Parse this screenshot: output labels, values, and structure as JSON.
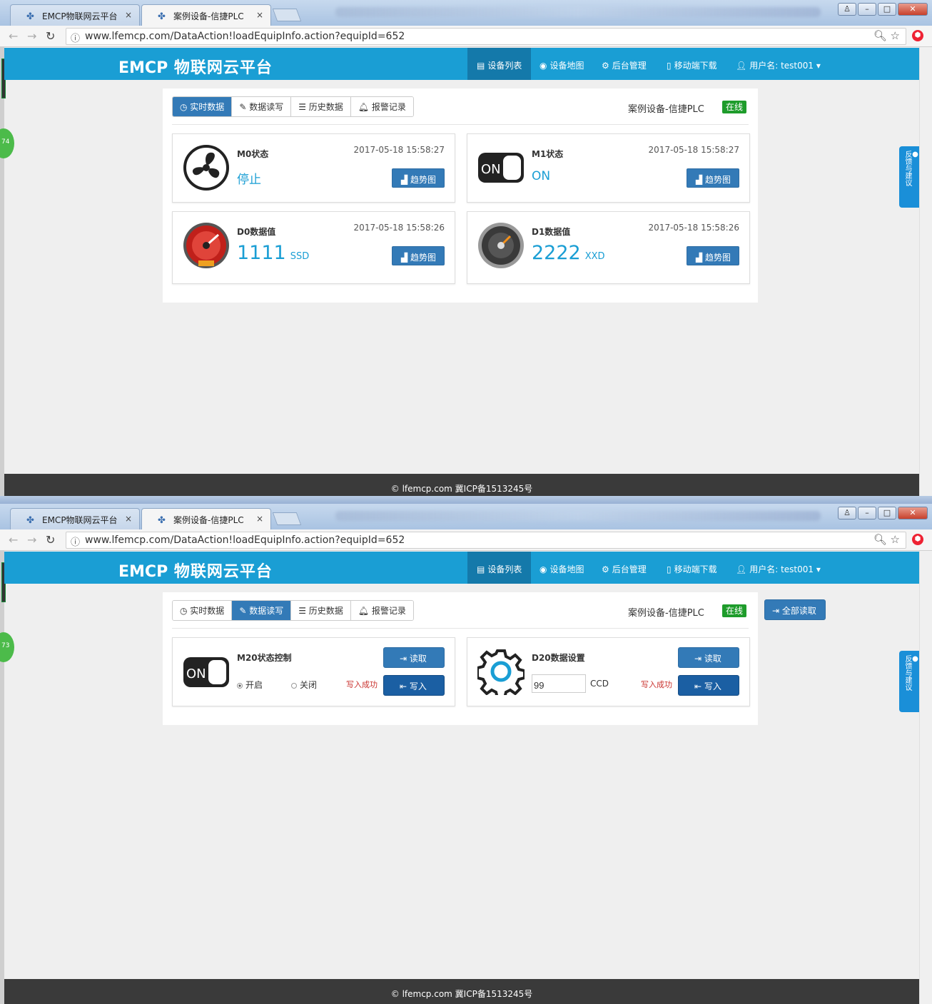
{
  "browser": {
    "tabs": [
      {
        "label": "EMCP物联网云平台"
      },
      {
        "label": "案例设备-信捷PLC"
      }
    ],
    "close_glyph": "×",
    "url": "www.lfemcp.com/DataAction!loadEquipInfo.action?equipId=652"
  },
  "side_badges": [
    "74",
    "73"
  ],
  "header": {
    "logo_brand": "EMCP",
    "logo_text": "物联网云平台",
    "menu": [
      {
        "label": "设备列表",
        "icon": "list-icon"
      },
      {
        "label": "设备地图",
        "icon": "globe-icon"
      },
      {
        "label": "后台管理",
        "icon": "gears-icon"
      },
      {
        "label": "移动端下载",
        "icon": "mobile-icon"
      },
      {
        "label": "用户名: test001",
        "icon": "user-icon"
      }
    ]
  },
  "subtabs": [
    {
      "label": "实时数据",
      "icon": "clock-icon"
    },
    {
      "label": "数据读写",
      "icon": "pencil-icon"
    },
    {
      "label": "历史数据",
      "icon": "list-icon"
    },
    {
      "label": "报警记录",
      "icon": "bell-icon"
    }
  ],
  "device": {
    "name": "案例设备-信捷PLC",
    "status": "在线"
  },
  "realtime": {
    "trend_label": "趋势图",
    "cards": [
      {
        "title": "M0状态",
        "time": "2017-05-18 15:58:27",
        "value": "停止",
        "icon": "fan-icon"
      },
      {
        "title": "M1状态",
        "time": "2017-05-18 15:58:27",
        "value": "ON",
        "icon": "switch-on-icon"
      },
      {
        "title": "D0数据值",
        "time": "2017-05-18 15:58:26",
        "value": "1111",
        "unit": "SSD",
        "icon": "red-gauge-icon"
      },
      {
        "title": "D1数据值",
        "time": "2017-05-18 15:58:26",
        "value": "2222",
        "unit": "XXD",
        "icon": "grey-gauge-icon"
      }
    ]
  },
  "readwrite": {
    "read_all_label": "全部读取",
    "read_label": "读取",
    "write_label": "写入",
    "success_label": "写入成功",
    "m20": {
      "title": "M20状态控制",
      "options": [
        "开启",
        "关闭"
      ],
      "selected": "开启"
    },
    "d20": {
      "title": "D20数据设置",
      "value": "99",
      "unit": "CCD"
    }
  },
  "switch_text": "ON",
  "footer": {
    "text": "lfemcp.com 冀ICP备1513245号"
  },
  "feedback": {
    "label": "反馈与建议"
  },
  "colors": {
    "header": "#1a9ed4",
    "primary_button": "#337ab7",
    "online": "#1e9c2b",
    "footer": "#3a3a3a"
  }
}
